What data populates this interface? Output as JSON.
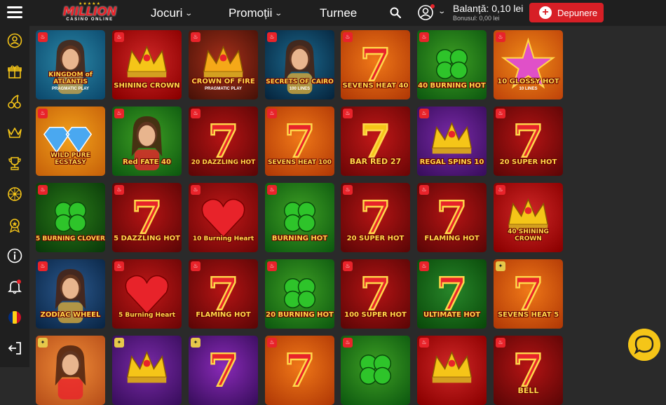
{
  "header": {
    "logo_stars": "★★★★★",
    "logo_name": "MILLION",
    "logo_sub": "CASINO ONLINE",
    "nav": [
      {
        "label": "Jocuri",
        "dropdown": true
      },
      {
        "label": "Promoții",
        "dropdown": true
      },
      {
        "label": "Turnee",
        "dropdown": false
      }
    ],
    "balance": "Balanță: 0,10 lei",
    "bonus": "Bonusul: 0,00 lei",
    "deposit_label": "Depunere",
    "accent_color": "#d71f26"
  },
  "sidebar": {
    "icons": [
      "user-icon",
      "gift-icon",
      "cherries-icon",
      "crown-icon",
      "trophy-icon",
      "wheel-icon",
      "medal-icon",
      "info-icon",
      "bell-icon",
      "romania-flag-icon",
      "logout-icon"
    ]
  },
  "games": [
    {
      "title": "KINGDOM of ATLANTIS",
      "provider": "PRAGMATIC PLAY",
      "theme": "atlantis",
      "badge": "hot"
    },
    {
      "title": "SHINING CROWN",
      "provider": "",
      "theme": "crown",
      "badge": "hot"
    },
    {
      "title": "CROWN OF FIRE",
      "provider": "PRAGMATIC PLAY",
      "theme": "crownfire",
      "badge": "hot"
    },
    {
      "title": "SECRETS OF CAIRO",
      "provider": "100 LINES",
      "theme": "cairo",
      "badge": "hot"
    },
    {
      "title": "SEVENS HEAT 40",
      "provider": "",
      "theme": "sevens-orange",
      "badge": "hot"
    },
    {
      "title": "40 BURNING HOT",
      "provider": "",
      "theme": "clover",
      "badge": "hot"
    },
    {
      "title": "10 GLOSSY HOT",
      "provider": "10 LINES",
      "theme": "star",
      "badge": "hot"
    },
    {
      "title": "WILD PURE ECSTASY",
      "provider": "",
      "theme": "diamond",
      "badge": "hot"
    },
    {
      "title": "Red FATE 40",
      "provider": "",
      "theme": "lady-green",
      "badge": "hot"
    },
    {
      "title": "20 DAZZLING HOT",
      "provider": "",
      "theme": "seven-red",
      "badge": "hot"
    },
    {
      "title": "SEVENS HEAT 100",
      "provider": "",
      "theme": "sevens-orange",
      "badge": "hot"
    },
    {
      "title": "BAR RED 27",
      "provider": "",
      "theme": "bar-red",
      "badge": "hot"
    },
    {
      "title": "REGAL SPINS 10",
      "provider": "",
      "theme": "crown-purple",
      "badge": "hot"
    },
    {
      "title": "20 SUPER HOT",
      "provider": "",
      "theme": "seven-red",
      "badge": "hot"
    },
    {
      "title": "5 BURNING CLOVER",
      "provider": "",
      "theme": "clover-dark",
      "badge": "hot"
    },
    {
      "title": "5 DAZZLING HOT",
      "provider": "",
      "theme": "seven-red",
      "badge": "hot"
    },
    {
      "title": "10 Burning Heart",
      "provider": "",
      "theme": "heart",
      "badge": "hot"
    },
    {
      "title": "BURNING HOT",
      "provider": "",
      "theme": "clover",
      "badge": "hot"
    },
    {
      "title": "20 SUPER HOT",
      "provider": "",
      "theme": "seven-red",
      "badge": "hot"
    },
    {
      "title": "FLAMING HOT",
      "provider": "",
      "theme": "seven-red",
      "badge": "hot"
    },
    {
      "title": "40 SHINING CROWN",
      "provider": "",
      "theme": "crown",
      "badge": "hot"
    },
    {
      "title": "ZODIAC WHEEL",
      "provider": "",
      "theme": "zodiac",
      "badge": "hot"
    },
    {
      "title": "5 Burning Heart",
      "provider": "",
      "theme": "heart",
      "badge": "hot"
    },
    {
      "title": "FLAMING HOT",
      "provider": "",
      "theme": "seven-red",
      "badge": "hot"
    },
    {
      "title": "20 BURNING HOT",
      "provider": "",
      "theme": "clover",
      "badge": "hot"
    },
    {
      "title": "100 SUPER HOT",
      "provider": "",
      "theme": "seven-red",
      "badge": "hot"
    },
    {
      "title": "ULTIMATE HOT",
      "provider": "",
      "theme": "seven-green",
      "badge": "hot"
    },
    {
      "title": "SEVENS HEAT 5",
      "provider": "",
      "theme": "sevens-orange",
      "badge": "new"
    },
    {
      "title": "",
      "provider": "",
      "theme": "lady-orange",
      "badge": "new"
    },
    {
      "title": "",
      "provider": "",
      "theme": "crown-purple",
      "badge": "new"
    },
    {
      "title": "",
      "provider": "",
      "theme": "sevens-purple",
      "badge": "new"
    },
    {
      "title": "",
      "provider": "",
      "theme": "sevens-orange",
      "badge": "hot"
    },
    {
      "title": "",
      "provider": "",
      "theme": "clover",
      "badge": "hot"
    },
    {
      "title": "",
      "provider": "",
      "theme": "crown",
      "badge": "hot"
    },
    {
      "title": "BELL",
      "provider": "",
      "theme": "seven-red",
      "badge": "hot"
    }
  ]
}
